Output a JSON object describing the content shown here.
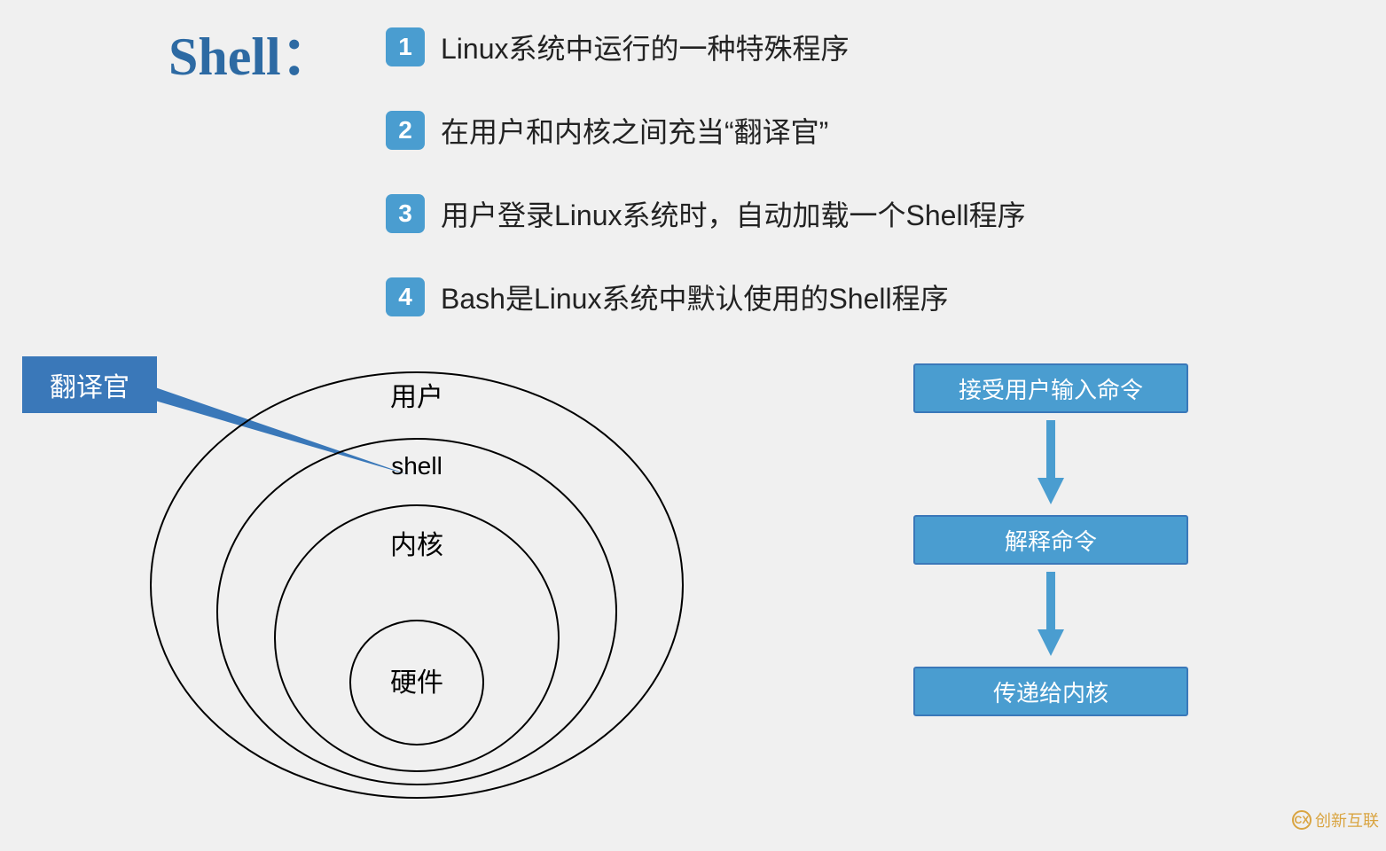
{
  "title": "Shell：",
  "bullets": [
    {
      "num": "1",
      "text": "Linux系统中运行的一种特殊程序"
    },
    {
      "num": "2",
      "text": "在用户和内核之间充当“翻译官”"
    },
    {
      "num": "3",
      "text": "用户登录Linux系统时，自动加载一个Shell程序"
    },
    {
      "num": "4",
      "text": "Bash是Linux系统中默认使用的Shell程序"
    }
  ],
  "callout": "翻译官",
  "layers": {
    "outer": "用户",
    "second": "shell",
    "third": "内核",
    "inner": "硬件"
  },
  "flow": {
    "step1": "接受用户输入命令",
    "step2": "解释命令",
    "step3": "传递给内核"
  },
  "watermark": "创新互联",
  "colors": {
    "accent": "#4a9dd0",
    "title": "#2d6aa3",
    "callout": "#3a78b9"
  }
}
